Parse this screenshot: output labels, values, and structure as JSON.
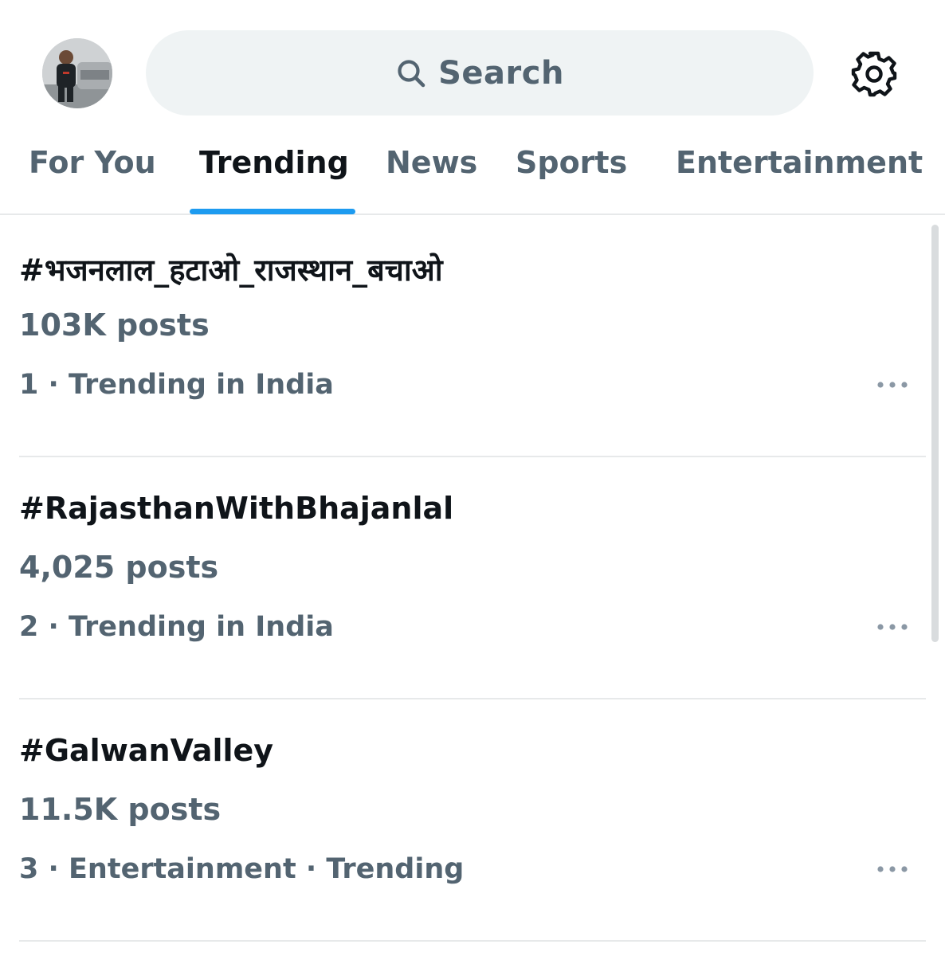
{
  "header": {
    "avatar_icon": "profile-avatar",
    "search": {
      "icon": "search-icon",
      "label": "Search"
    },
    "settings_icon": "gear-icon"
  },
  "tabs": [
    {
      "label": "For You",
      "active": false
    },
    {
      "label": "Trending",
      "active": true
    },
    {
      "label": "News",
      "active": false
    },
    {
      "label": "Sports",
      "active": false
    },
    {
      "label": "Entertainment",
      "active": false
    }
  ],
  "trends": [
    {
      "title": "#भजनलाल_हटाओ_राजस्थान_बचाओ",
      "posts": "103K posts",
      "meta": "1 · Trending in India"
    },
    {
      "title": "#RajasthanWithBhajanlal",
      "posts": "4,025 posts",
      "meta": "2 · Trending in India"
    },
    {
      "title": "#GalwanValley",
      "posts": "11.5K posts",
      "meta": "3 · Entertainment · Trending"
    }
  ],
  "colors": {
    "accent": "#1d9bf0",
    "text_primary": "#0f1419",
    "text_secondary": "#536471",
    "search_bg": "#eff3f4",
    "divider": "#e7e9ea"
  }
}
